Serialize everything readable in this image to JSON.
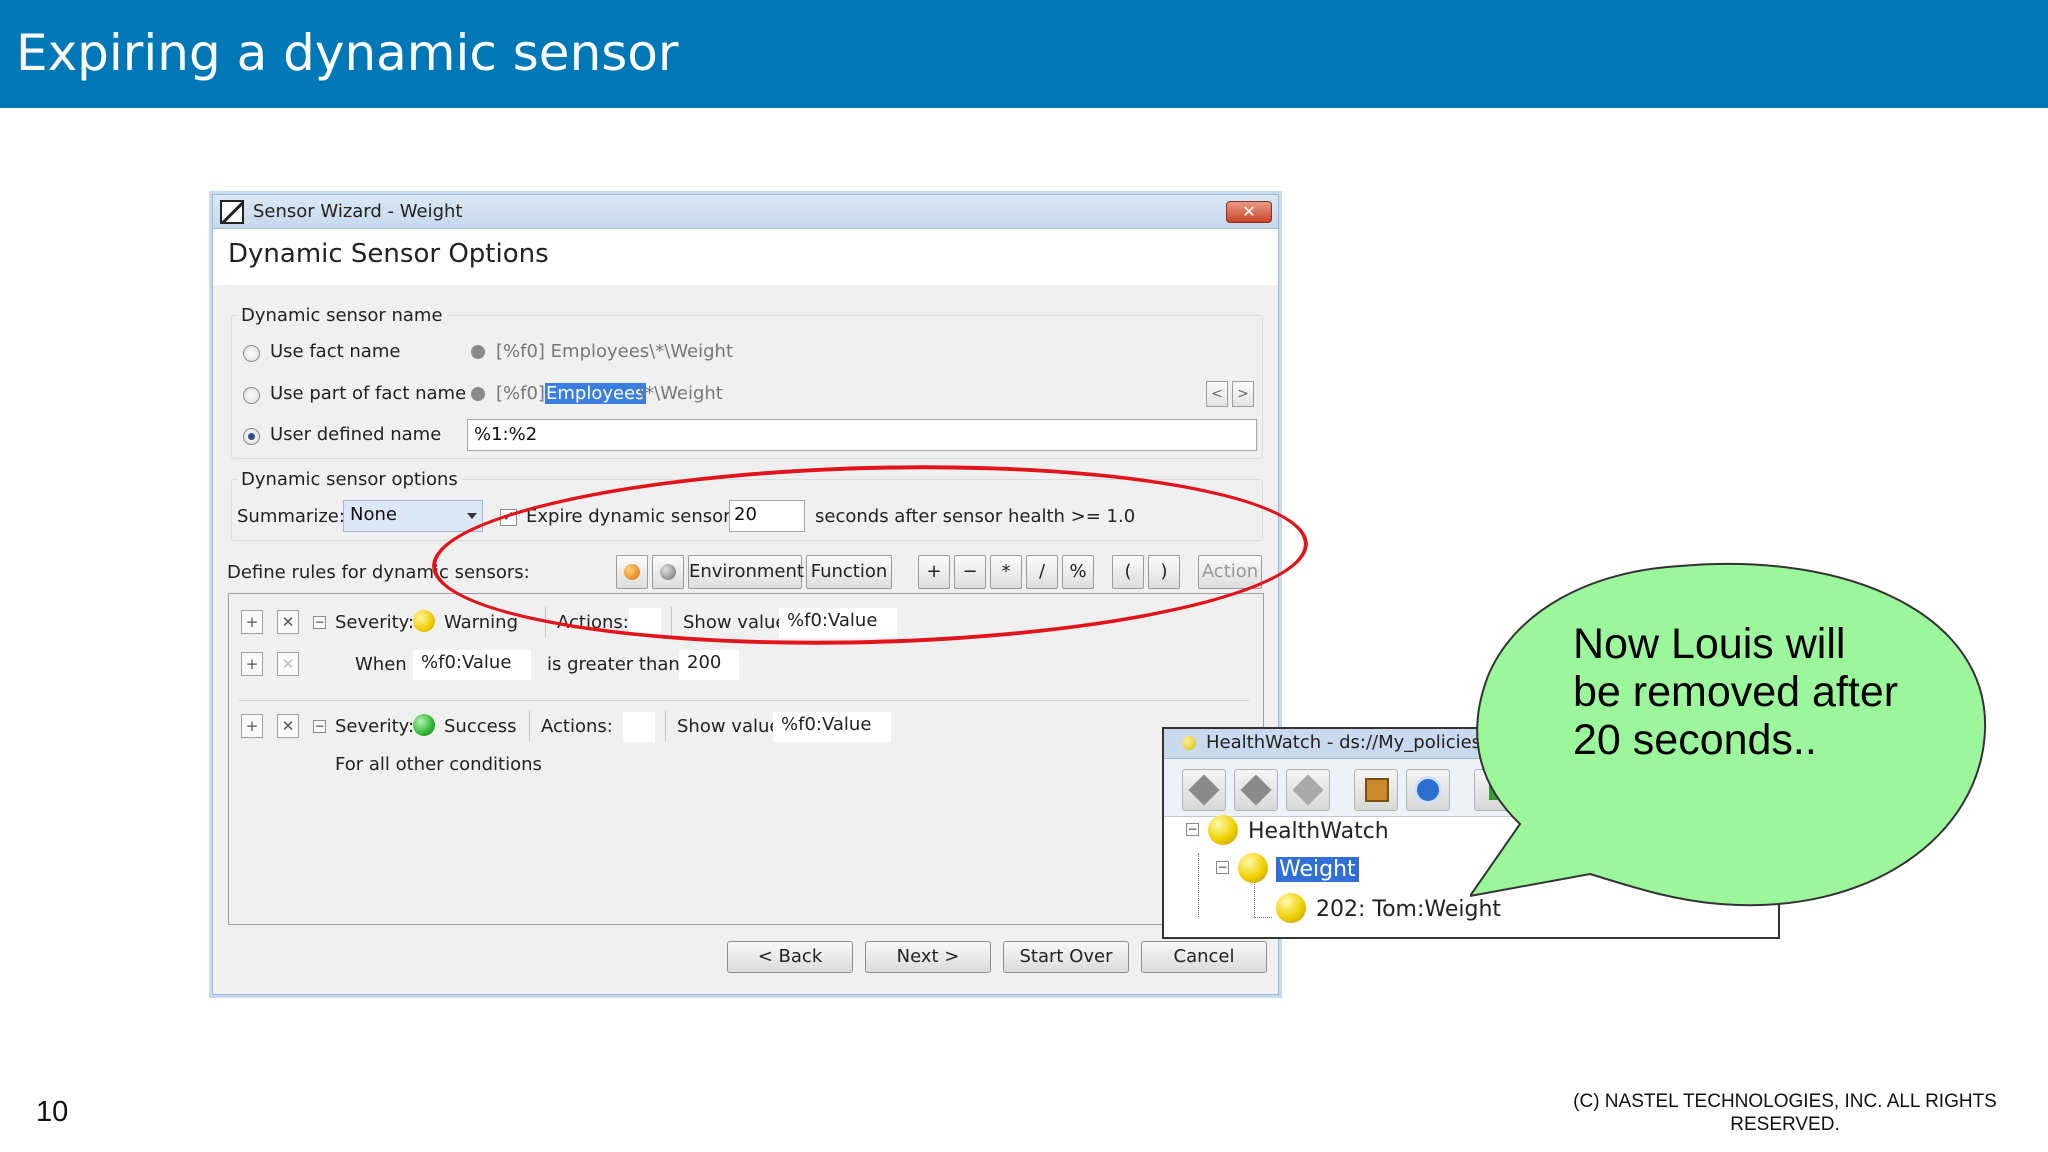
{
  "slide": {
    "title": "Expiring a dynamic sensor",
    "page_number": "10",
    "copyright": "(C) NASTEL TECHNOLOGIES, INC. ALL RIGHTS RESERVED."
  },
  "wizard": {
    "window_title": "Sensor Wizard - Weight",
    "close_label": "✕",
    "page_heading": "Dynamic Sensor Options",
    "name_group": {
      "legend": "Dynamic sensor name",
      "use_fact_name": "Use fact name",
      "use_fact_name_preview": "[%f0] Employees\\*\\Weight",
      "use_part_label": "Use part of fact name",
      "use_part_prefix": "[%f0]",
      "use_part_selected": "Employees",
      "use_part_suffix": "\\*\\Weight",
      "prev_label": "<",
      "next_label": ">",
      "user_defined_label": "User defined name",
      "user_defined_value": "%1:%2",
      "selected_option": "user_defined"
    },
    "options_group": {
      "legend": "Dynamic sensor options",
      "summarize_label": "Summarize:",
      "summarize_value": "None",
      "expire_label": "Expire dynamic sensor",
      "expire_checked": true,
      "expire_value": "20",
      "expire_suffix": "seconds after sensor health >= 1.0"
    },
    "rules_toolbar": {
      "label": "Define rules for dynamic sensors:",
      "environment": "Environment",
      "function": "Function",
      "plus": "+",
      "minus": "−",
      "multiply": "*",
      "divide": "/",
      "percent": "%",
      "open_paren": "(",
      "close_paren": ")",
      "action": "Action"
    },
    "rules": [
      {
        "severity_label": "Severity:",
        "severity": "Warning",
        "severity_color": "#f0cc00",
        "actions_label": "Actions:",
        "show_value_label": "Show value:",
        "show_value": "%f0:Value",
        "condition": {
          "when_label": "When",
          "field": "%f0:Value",
          "operator": "is greater than",
          "value": "200"
        }
      },
      {
        "severity_label": "Severity:",
        "severity": "Success",
        "severity_color": "#2fb52f",
        "actions_label": "Actions:",
        "show_value_label": "Show value:",
        "show_value": "%f0:Value",
        "other_conditions": "For all other conditions"
      }
    ],
    "buttons": {
      "back": "< Back",
      "next": "Next >",
      "start_over": "Start Over",
      "cancel": "Cancel"
    }
  },
  "healthwatch": {
    "title": "HealthWatch - ds://My_policies/",
    "tree": {
      "root": "HealthWatch",
      "child": "Weight",
      "grandchild": "202: Tom:Weight"
    }
  },
  "callout": {
    "text": "Now Louis will be removed after 20 seconds..",
    "fill": "#9cf79c"
  }
}
